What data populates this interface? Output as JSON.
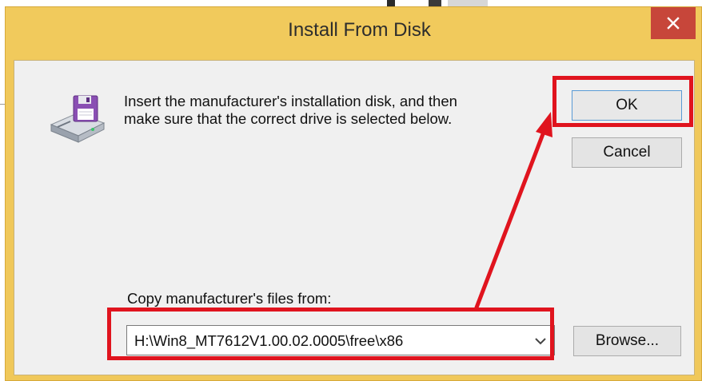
{
  "window": {
    "title": "Install From Disk",
    "close_glyph": "✕"
  },
  "dialog": {
    "message_line1": "Insert the manufacturer's installation disk, and then",
    "message_line2": "make sure that the correct drive is selected below.",
    "ok_label": "OK",
    "cancel_label": "Cancel",
    "copy_label": "Copy manufacturer's files from:",
    "path_value": "H:\\Win8_MT7612V1.00.02.0005\\free\\x86",
    "browse_label": "Browse..."
  },
  "icons": {
    "disk": "floppy-drive-icon",
    "close": "close-icon",
    "dropdown": "chevron-down-icon"
  },
  "colors": {
    "titlebar": "#f1ca5c",
    "close_button": "#c7463a",
    "annotation": "#e0141e",
    "client_bg": "#f0f0f0"
  }
}
